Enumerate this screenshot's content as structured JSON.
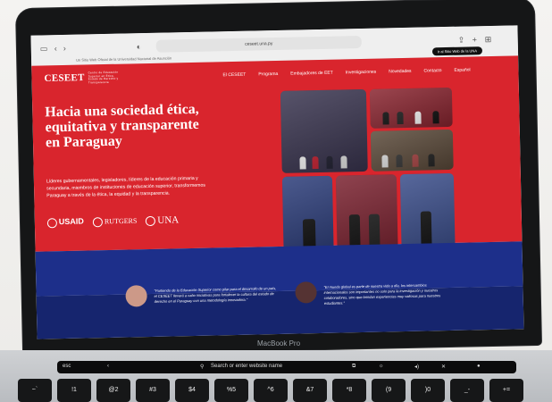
{
  "browser": {
    "url": "ceseet.una.py",
    "subbar_text": "Un Sitio Web Oficial de la Universidad Nacional de Asunción",
    "pill_label": "Ir al Sitio Web de la UNA"
  },
  "site": {
    "logo": "CESEET",
    "logo_tagline": "Centro de Educación Superior en Ética, Estado de Derecho y Transparencia",
    "menu": [
      "El CESEET",
      "Programa",
      "Embajadores de EET",
      "Investigaciones",
      "Novedades",
      "Contacto",
      "Español"
    ],
    "headline": "Hacia una sociedad ética, equitativa y transparente en Paraguay",
    "body": "Líderes gubernamentales, legisladores, líderes de la educación primaria y secundaria, miembros de instituciones de educación superior, transformemos Paraguay a través de la ética, la equidad y la transparencia.",
    "partners": [
      "USAID",
      "RUTGERS",
      "UNA"
    ],
    "quotes": [
      "\"Partiendo de la Educación Superior como pilar para el desarrollo de un país, el CESEET llevará a cabo iniciativas para fortalecer la cultura del estado de derecho en el Paraguay con una metodología innovadora.\"",
      "\"El mundo global es parte de nuestra vida a día, los intercambios internacionales son importantes no solo para la investigación y nuestros colaboradores, sino que brindan experiencias muy valiosas para nuestros estudiantes.\""
    ]
  },
  "laptop": {
    "brand": "MacBook Pro",
    "search_label": "Search or enter website name",
    "esc": "esc",
    "keys": [
      "~`",
      "!1",
      "@2",
      "#3",
      "$4",
      "%5",
      "^6",
      "&7",
      "*8",
      "(9",
      ")0",
      "_-",
      "+="
    ]
  },
  "colors": {
    "hero_red": "#d9252d",
    "blue_band": "#1d2f8a"
  }
}
